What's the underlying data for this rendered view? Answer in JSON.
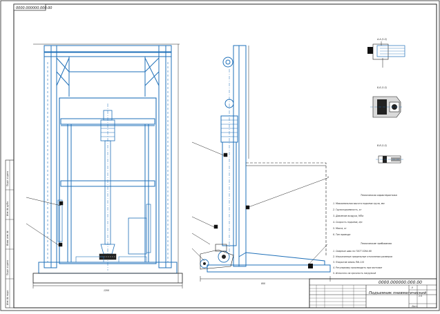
{
  "stamp": {
    "code": "0000.000000.000.00"
  },
  "title_block": {
    "code": "0000.000000.000.00",
    "title": "Подъемник пневматический",
    "sheet": "Лист",
    "scale": "1:5",
    "letter": "У"
  },
  "views": {
    "view_a": "А-А (1:2)",
    "view_b": "Б-Б (1:2)",
    "view_v": "В-В (1:2)"
  },
  "specs": {
    "heading": "Техническая характеристика",
    "items": [
      "1. Максимальная высота подъема груза, мм",
      "2. Грузоподъемность, кг",
      "3. Давление воздуха, МПа",
      "4. Скорость подъема, м/с",
      "5. Масса, кг",
      "6. Тип привода"
    ]
  },
  "req": {
    "heading": "Технические требования",
    "items": [
      "1. Сварные швы по ГОСТ 5264-80",
      "2. Неуказанные предельные отклонения размеров",
      "3. Покрытие эмаль ПФ-115",
      "4. Регулировку производить при монтаже",
      "5. Испытать на прочность нагрузкой"
    ]
  },
  "side_labels": [
    "Подп. и дата",
    "Инв. № дубл.",
    "Взам. инв. №",
    "Подп. и дата",
    "Инв. № подл."
  ],
  "markers": [
    "1",
    "2",
    "3",
    "4",
    "5",
    "6",
    "7",
    "8",
    "9"
  ]
}
